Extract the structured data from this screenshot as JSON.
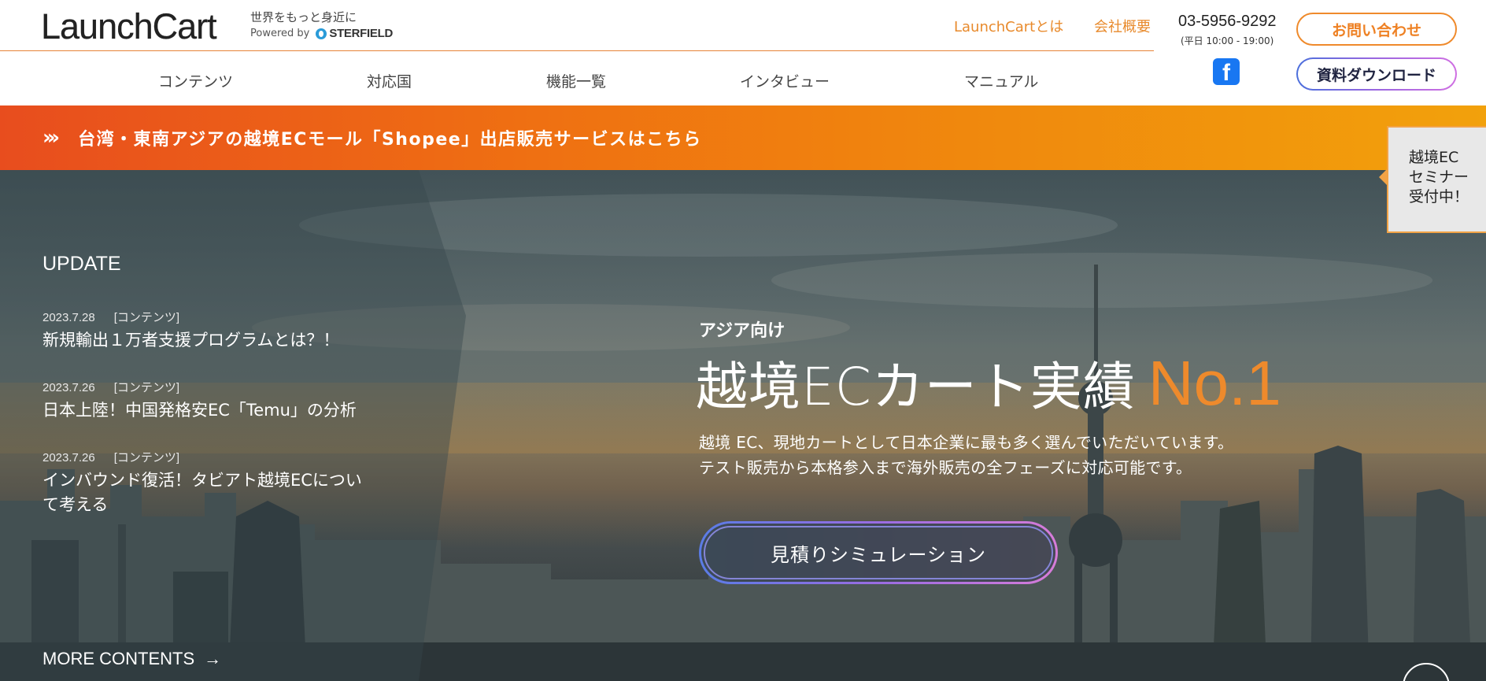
{
  "header": {
    "logo": "LaunchCart",
    "tagline": "世界をもっと身近に",
    "powered_by": "Powered by",
    "powered_brand": "STERFIELD",
    "links": {
      "about": "LaunchCartとは",
      "company": "会社概要"
    },
    "phone": "03-5956-9292",
    "hours": "(平日 10:00 - 19:00)",
    "contact_button": "お問い合わせ",
    "download_button": "資料ダウンロード",
    "facebook_glyph": "f"
  },
  "nav": {
    "items": [
      {
        "label": "コンテンツ"
      },
      {
        "label": "対応国"
      },
      {
        "label": "機能一覧"
      },
      {
        "label": "インタビュー"
      },
      {
        "label": "マニュアル"
      }
    ]
  },
  "banner": {
    "arrows": "›››",
    "text": "台湾・東南アジアの越境ECモール「Shopee」出店販売サービスはこちら"
  },
  "seminar_tab": {
    "line1": "越境EC",
    "line2": "セミナー",
    "line3": "受付中！"
  },
  "update": {
    "title": "UPDATE",
    "items": [
      {
        "date": "2023.7.28",
        "category": "[コンテンツ]",
        "title": "新規輸出１万者支援プログラムとは？！"
      },
      {
        "date": "2023.7.26",
        "category": "[コンテンツ]",
        "title": "日本上陸！中国発格安EC「Temu」の分析"
      },
      {
        "date": "2023.7.26",
        "category": "[コンテンツ]",
        "title": "インバウンド復活！タビアト越境ECについて考える"
      }
    ],
    "more": "MORE CONTENTS",
    "more_arrow": "→"
  },
  "hero": {
    "kicker": "アジア向け",
    "headline": "越境ECカート実績",
    "headline_accent": "No.1",
    "desc_line1": "越境 EC、現地カートとして日本企業に最も多く選んでいただいています。",
    "desc_line2": "テスト販売から本格参入まで海外販売の全フェーズに対応可能です。",
    "cta": "見積りシミュレーション",
    "next_arrow": "›"
  },
  "colors": {
    "accent_orange": "#ee8a2c",
    "banner_start": "#e84d1e",
    "banner_end": "#f2a10c",
    "facebook": "#1877f2",
    "gradient_blue": "#5a7ce6",
    "gradient_pink": "#d77cd9"
  }
}
